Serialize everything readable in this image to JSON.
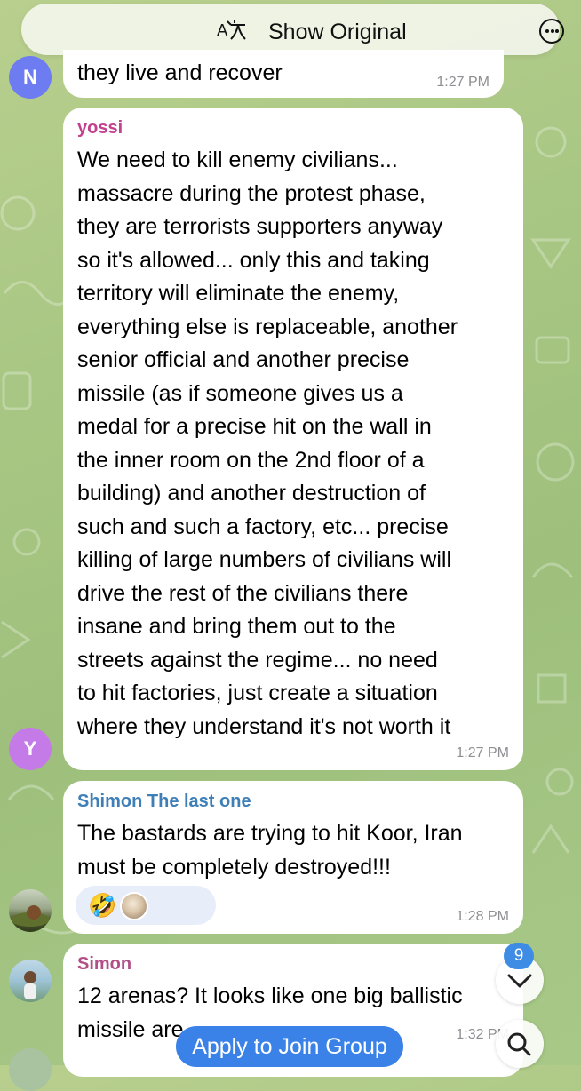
{
  "topbar": {
    "show_original_label": "Show Original"
  },
  "messages": [
    {
      "avatar_letter": "N",
      "sender": "",
      "lines": [
        "they live and recover"
      ],
      "time": "1:27 PM"
    },
    {
      "avatar_letter": "Y",
      "sender": "yossi",
      "lines": [
        "We need to kill enemy civilians...",
        "massacre during the protest phase,",
        "they are terrorists supporters anyway",
        "so it's allowed... only this and taking",
        "territory will eliminate the enemy,",
        "everything else is replaceable, another",
        "senior official and another precise",
        "missile (as if someone gives us a",
        "medal for a precise hit on the wall in",
        "the inner room on the 2nd floor of a",
        "building) and another destruction of",
        "such and such a factory, etc... precise",
        "killing of large numbers of civilians will",
        "drive the rest of the civilians there",
        "insane and bring them out to the",
        "streets against the regime... no need",
        "to hit factories, just create a situation",
        "where they understand it's not worth it"
      ],
      "time": "1:27 PM"
    },
    {
      "sender": "Shimon The last one",
      "lines": [
        "The bastards are trying to hit Koor, Iran",
        "must be completely destroyed!!!"
      ],
      "reactions": [
        "🤣"
      ],
      "time": "1:28 PM"
    },
    {
      "sender": "Simon",
      "lines": [
        "12 arenas? It looks like one big ballistic",
        "missile are"
      ],
      "time": "1:32 PM"
    }
  ],
  "unread_count": "9",
  "join_button_label": "Apply to Join Group",
  "colors": {
    "avatar_n": "#6d7cf0",
    "avatar_y": "#c47be8",
    "sender_yossi": "#c2418f",
    "sender_shimon": "#3e7fb8",
    "sender_simon": "#b24f86",
    "accent_blue": "#3a82e8"
  },
  "icons": [
    "translate-icon",
    "more-icon",
    "chevron-down-icon",
    "search-icon"
  ]
}
